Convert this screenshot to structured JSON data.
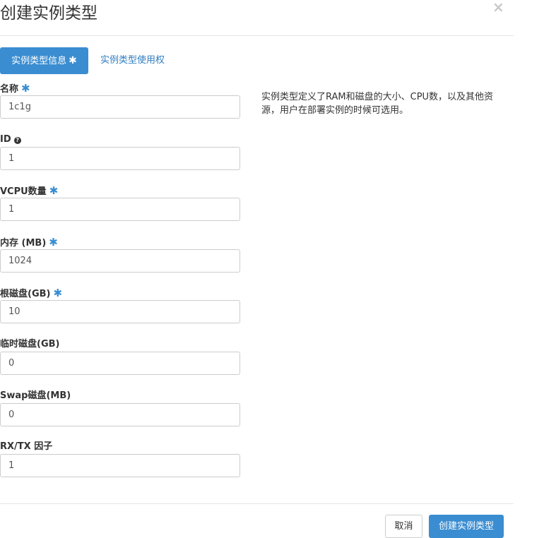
{
  "modal": {
    "title": "创建实例类型",
    "close_icon": "×"
  },
  "tabs": [
    {
      "label": "实例类型信息",
      "required_mark": "✱",
      "active": true
    },
    {
      "label": "实例类型使用权",
      "active": false
    }
  ],
  "fields": [
    {
      "label": "名称",
      "required": "✱",
      "value": "1c1g"
    },
    {
      "label": "ID",
      "help_icon": "?",
      "value": "1"
    },
    {
      "label": "VCPU数量",
      "required": "✱",
      "value": "1"
    },
    {
      "label": "内存 (MB)",
      "required": "✱",
      "value": "1024"
    },
    {
      "label": "根磁盘(GB)",
      "required": "✱",
      "value": "10"
    },
    {
      "label": "临时磁盘(GB)",
      "value": "0"
    },
    {
      "label": "Swap磁盘(MB)",
      "value": "0"
    },
    {
      "label": "RX/TX 因子",
      "value": "1"
    }
  ],
  "description": "实例类型定义了RAM和磁盘的大小、CPU数，以及其他资源，用户在部署实例的时候可选用。",
  "footer": {
    "cancel_label": "取消",
    "submit_label": "创建实例类型"
  },
  "colors": {
    "primary": "#3a8dd1",
    "link": "#2f7dc0",
    "border": "#cccccc"
  }
}
